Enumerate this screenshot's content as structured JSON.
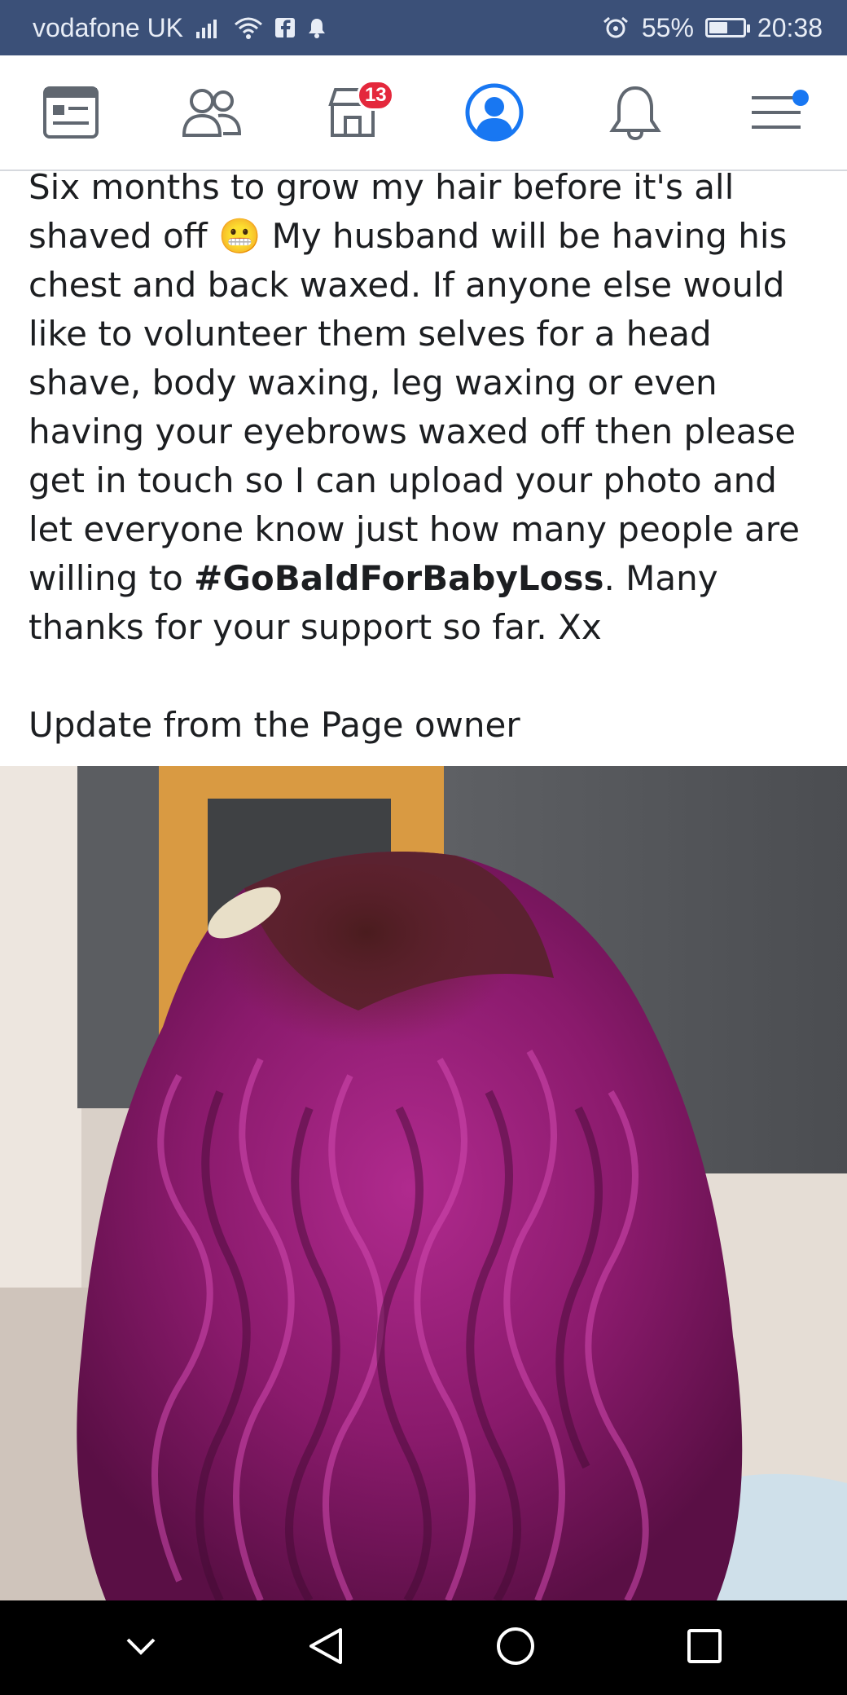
{
  "status_bar": {
    "carrier": "vodafone UK",
    "battery": "55%",
    "battery_level": 0.55,
    "time": "20:38"
  },
  "nav": {
    "marketplace_badge": "13"
  },
  "post": {
    "line1": "Six months to grow my hair before it's all",
    "line2_pre": "shaved off ",
    "line2_emoji": "😬",
    "body_rest": " My husband will be having his chest and back waxed. If anyone else would like to volunteer them selves for a head shave, body waxing, leg waxing or even having your eyebrows waxed off then please get in touch so I can upload your photo and let everyone know just how many people are willing to ",
    "hashtag": "#GoBaldForBabyLoss",
    "text_after_hashtag": ". Many thanks for your support so far. Xx",
    "update_line": "Update from the Page owner"
  },
  "colors": {
    "status_bar": "#3b5078",
    "badge": "#e4283c",
    "accent": "#1877f2",
    "hair": "#8c1a6e"
  }
}
